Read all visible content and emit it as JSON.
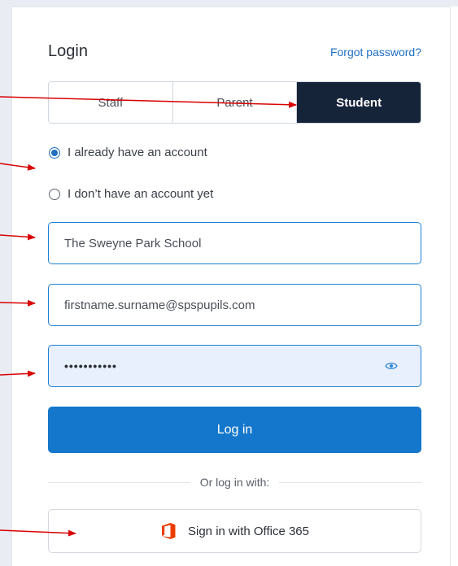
{
  "form": {
    "title": "Login",
    "forgot_password": "Forgot password?"
  },
  "tabs": [
    {
      "label": "Staff",
      "active": false
    },
    {
      "label": "Parent",
      "active": false
    },
    {
      "label": "Student",
      "active": true
    }
  ],
  "account_options": [
    {
      "label": "I already have an account",
      "checked": true
    },
    {
      "label": "I don’t have an account yet",
      "checked": false
    }
  ],
  "school_field": {
    "value": "The Sweyne Park School"
  },
  "email_field": {
    "value": "firstname.surname@spspupils.com"
  },
  "password_field": {
    "masked_value": "•••••••••••"
  },
  "login_button": {
    "label": "Log in"
  },
  "alt_login": {
    "divider_text": "Or log in with:",
    "office365_label": "Sign in with Office 365"
  },
  "colors": {
    "accent": "#1477cc",
    "active_tab": "#16243a",
    "annotation_arrows": "#d90000",
    "office_logo": "#eb3c00"
  }
}
